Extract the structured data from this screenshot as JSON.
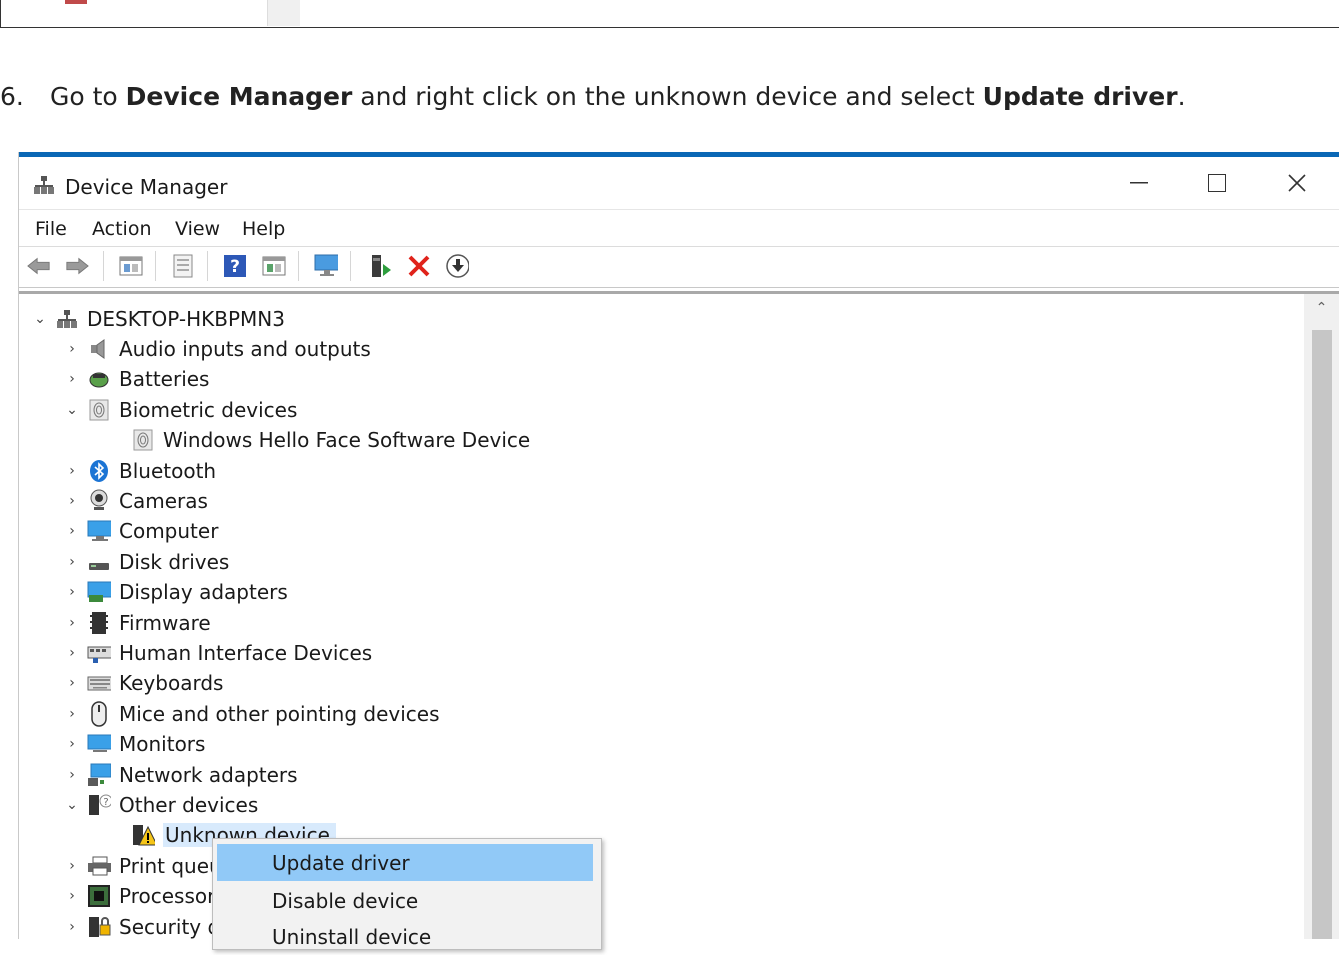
{
  "instruction": {
    "number": "6.",
    "prefix": "Go to ",
    "bold1": "Device Manager",
    "middle": " and right click on the unknown device and select ",
    "bold2": "Update driver",
    "suffix": "."
  },
  "window": {
    "title": "Device Manager",
    "accent_color": "#0a67b5",
    "menu": [
      "File",
      "Action",
      "View",
      "Help"
    ],
    "toolbar_icons": [
      "back-arrow-icon",
      "forward-arrow-icon",
      "properties-icon",
      "update-icon",
      "help-icon",
      "show-hidden-icon",
      "monitor-icon",
      "add-driver-icon",
      "uninstall-x-icon",
      "download-icon"
    ]
  },
  "tree": {
    "root": "DESKTOP-HKBPMN3",
    "items": [
      {
        "label": "Audio inputs and outputs",
        "icon": "speaker-icon",
        "state": "collapsed",
        "level": 1
      },
      {
        "label": "Batteries",
        "icon": "battery-icon",
        "state": "collapsed",
        "level": 1
      },
      {
        "label": "Biometric devices",
        "icon": "fingerprint-icon",
        "state": "expanded",
        "level": 1
      },
      {
        "label": "Windows Hello Face Software Device",
        "icon": "fingerprint-icon",
        "state": "leaf",
        "level": 2
      },
      {
        "label": "Bluetooth",
        "icon": "bluetooth-icon",
        "state": "collapsed",
        "level": 1
      },
      {
        "label": "Cameras",
        "icon": "camera-icon",
        "state": "collapsed",
        "level": 1
      },
      {
        "label": "Computer",
        "icon": "computer-icon",
        "state": "collapsed",
        "level": 1
      },
      {
        "label": "Disk drives",
        "icon": "disk-icon",
        "state": "collapsed",
        "level": 1
      },
      {
        "label": "Display adapters",
        "icon": "display-adapter-icon",
        "state": "collapsed",
        "level": 1
      },
      {
        "label": "Firmware",
        "icon": "firmware-icon",
        "state": "collapsed",
        "level": 1
      },
      {
        "label": "Human Interface Devices",
        "icon": "hid-icon",
        "state": "collapsed",
        "level": 1
      },
      {
        "label": "Keyboards",
        "icon": "keyboard-icon",
        "state": "collapsed",
        "level": 1
      },
      {
        "label": "Mice and other pointing devices",
        "icon": "mouse-icon",
        "state": "collapsed",
        "level": 1
      },
      {
        "label": "Monitors",
        "icon": "monitor-icon",
        "state": "collapsed",
        "level": 1
      },
      {
        "label": "Network adapters",
        "icon": "network-icon",
        "state": "collapsed",
        "level": 1
      },
      {
        "label": "Other devices",
        "icon": "unknown-category-icon",
        "state": "expanded",
        "level": 1
      },
      {
        "label": "Unknown device",
        "icon": "warning-device-icon",
        "state": "leaf",
        "level": 2,
        "selected": true
      },
      {
        "label": "Print queu",
        "icon": "printer-icon",
        "state": "collapsed",
        "level": 1
      },
      {
        "label": "Processor:",
        "icon": "processor-icon",
        "state": "collapsed",
        "level": 1
      },
      {
        "label": "Security d",
        "icon": "security-icon",
        "state": "collapsed",
        "level": 1
      }
    ]
  },
  "context_menu": {
    "items": [
      "Update driver",
      "Disable device",
      "Uninstall device"
    ],
    "highlighted_index": 0,
    "highlight_color": "#91c9f7"
  }
}
